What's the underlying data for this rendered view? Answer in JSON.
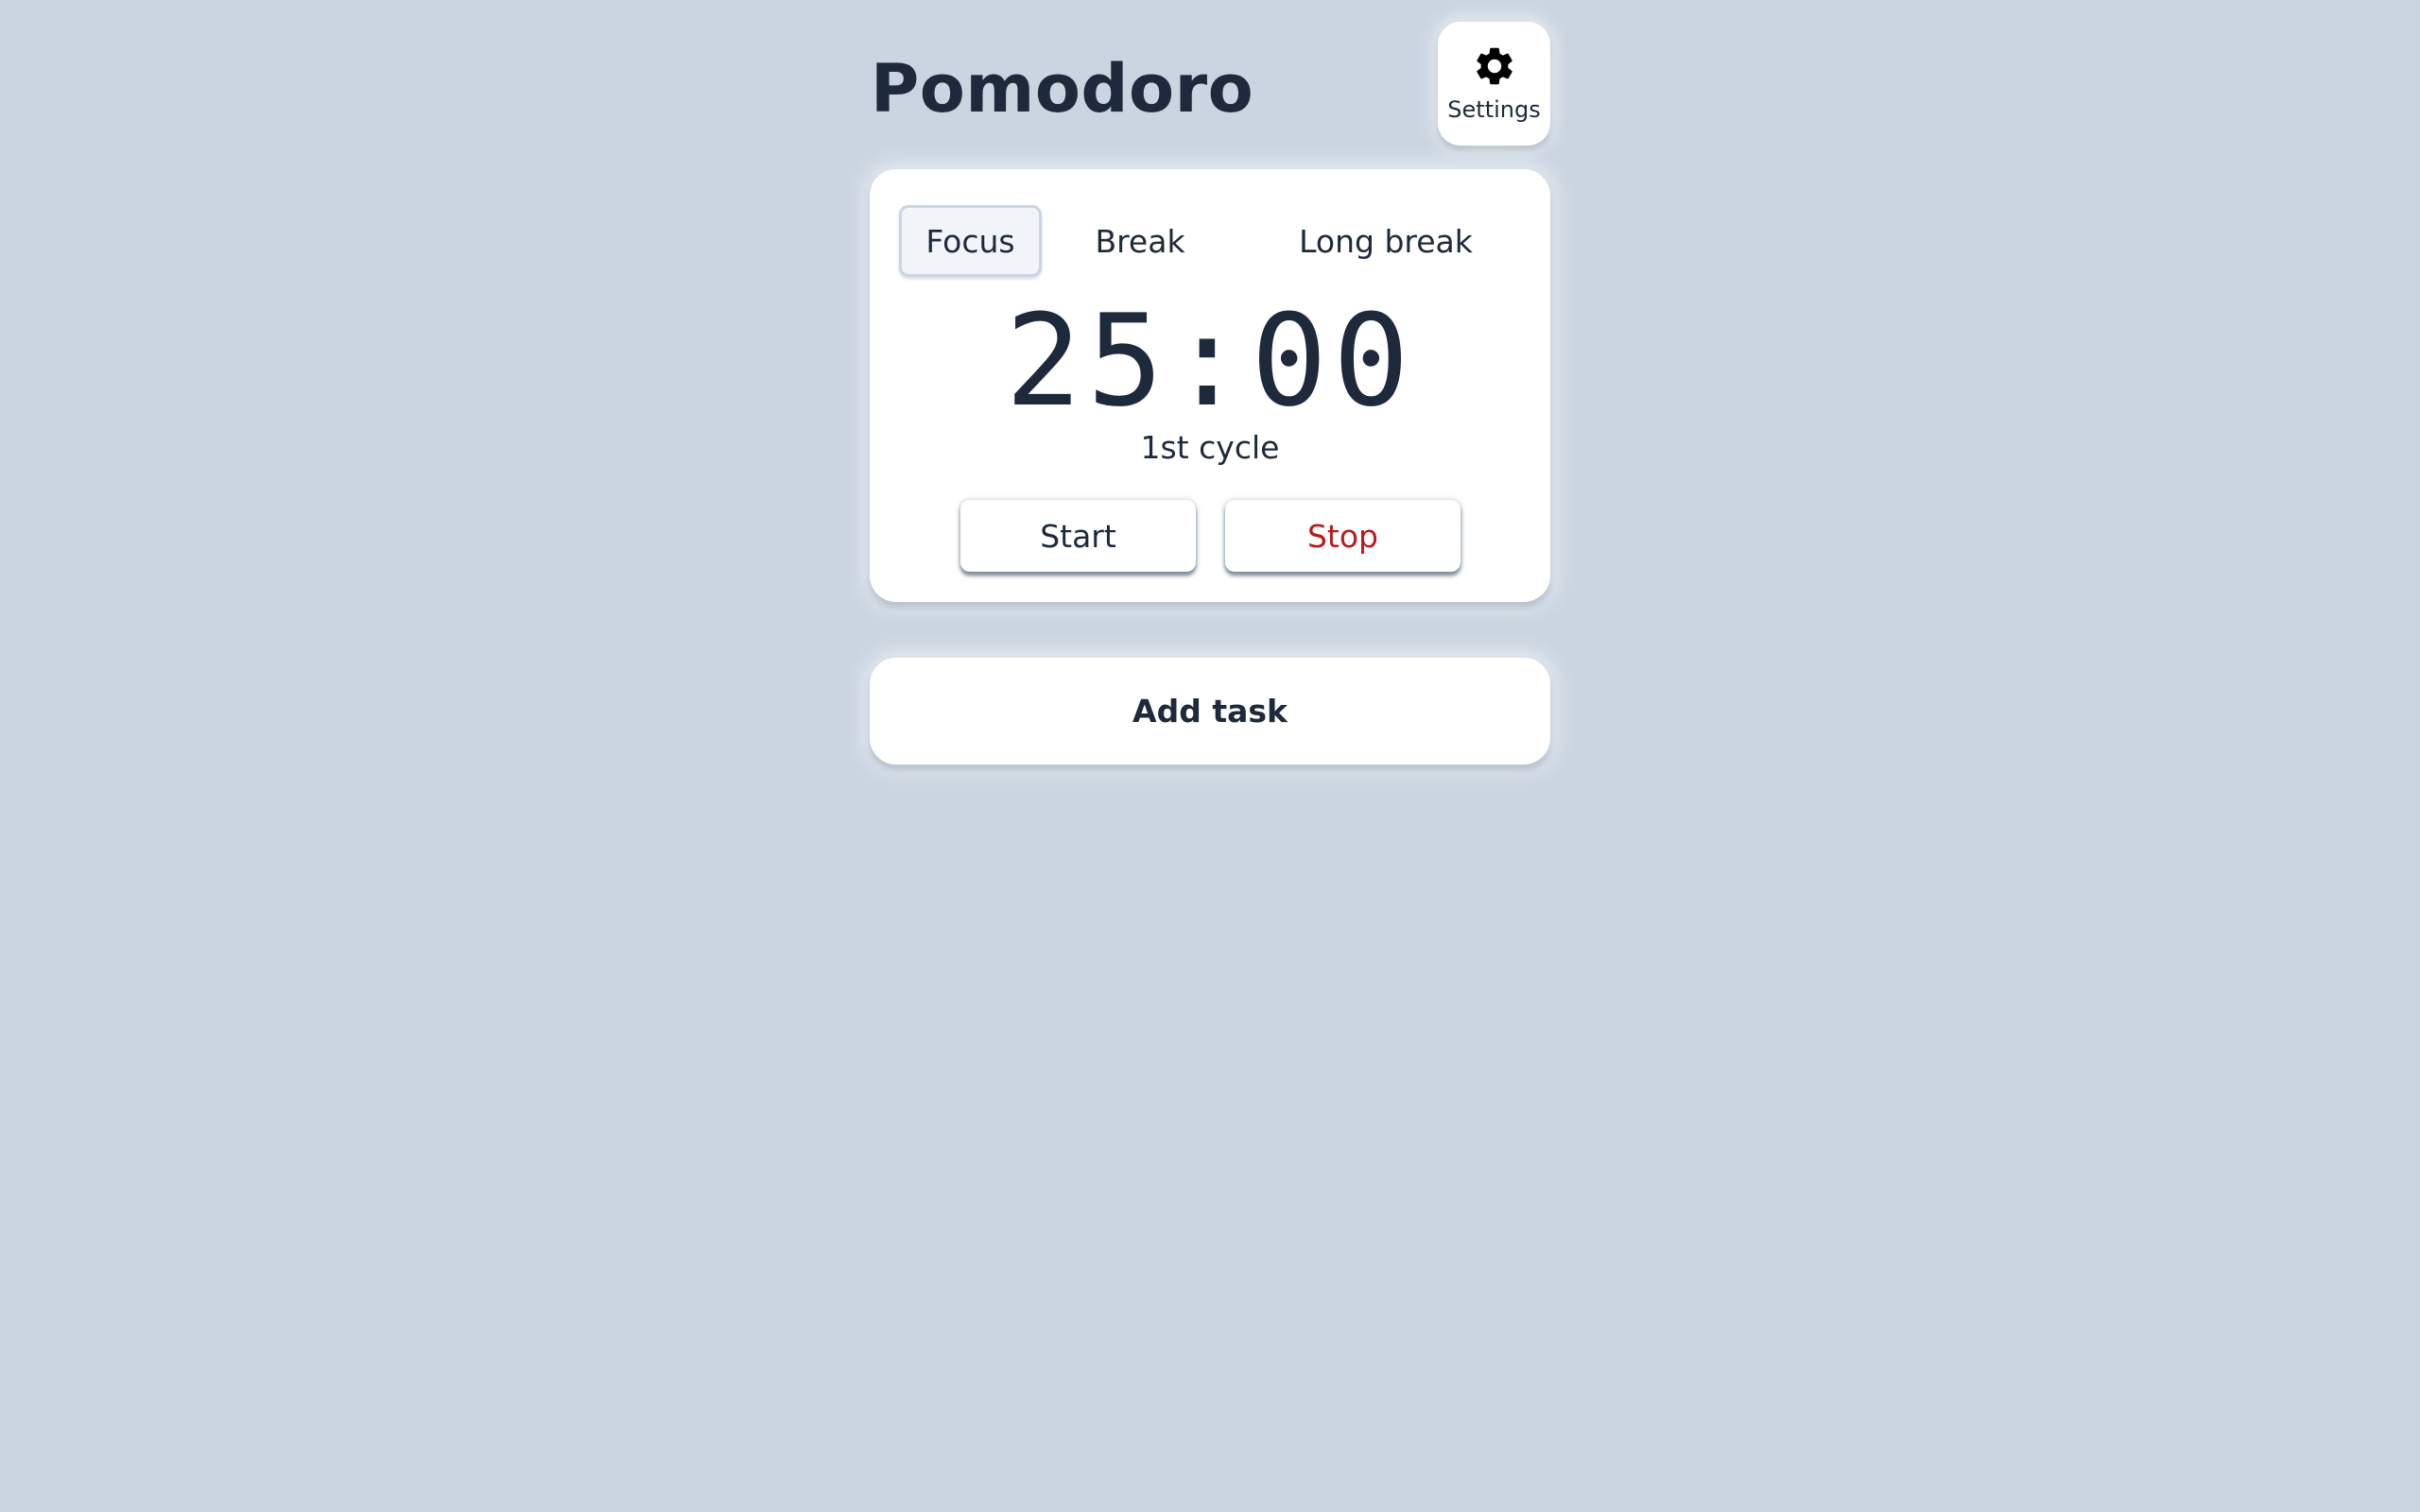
{
  "header": {
    "title": "Pomodoro",
    "settings": {
      "icon": "gear-icon",
      "label": "Settings"
    }
  },
  "timer": {
    "tabs": [
      {
        "label": "Focus",
        "selected": true
      },
      {
        "label": "Break",
        "selected": false
      },
      {
        "label": "Long break",
        "selected": false
      }
    ],
    "time": "25:00",
    "cycle": "1st cycle",
    "start_label": "Start",
    "stop_label": "Stop"
  },
  "tasks": {
    "add_label": "Add task"
  },
  "colors": {
    "background": "#cbd5e1",
    "card": "#ffffff",
    "text": "#1e293b",
    "stop": "#b91c1c",
    "selected_tab": "#f1f5f9"
  }
}
